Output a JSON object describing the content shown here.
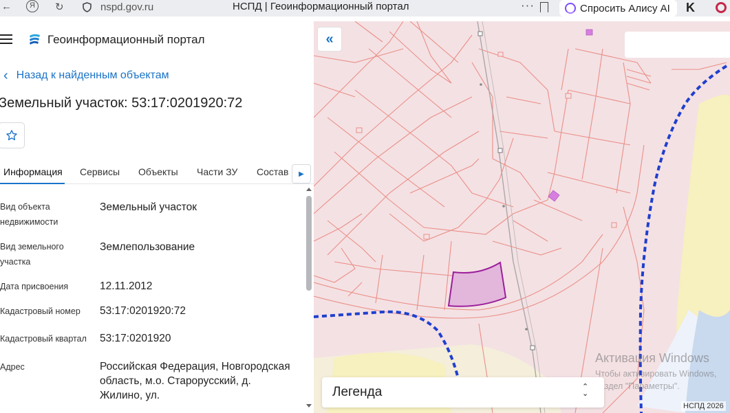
{
  "browser": {
    "url": "nspd.gov.ru",
    "tab_title": "НСПД | Геоинформационный портал",
    "alice_label": "Спросить Алису AI",
    "menu_dots": "···"
  },
  "header": {
    "portal_title": "Геоинформационный портал"
  },
  "navigation": {
    "back_label": "Назад к найденным объектам",
    "back_chevron": "‹"
  },
  "object": {
    "title": "Земельный участок: 53:17:0201920:72"
  },
  "tabs": [
    {
      "label": "Информация",
      "active": true
    },
    {
      "label": "Сервисы"
    },
    {
      "label": "Объекты"
    },
    {
      "label": "Части ЗУ"
    },
    {
      "label": "Состав"
    }
  ],
  "attributes": [
    {
      "label": "Вид объекта недвижимости",
      "value": "Земельный участок"
    },
    {
      "label": "Вид земельного участка",
      "value": "Землепользование"
    },
    {
      "label": "Дата присвоения",
      "value": "12.11.2012"
    },
    {
      "label": "Кадастровый номер",
      "value": "53:17:0201920:72"
    },
    {
      "label": "Кадастровый квартал",
      "value": "53:17:0201920"
    },
    {
      "label": "Адрес",
      "value": "Российская Федерация, Новгородская область, м.о. Старорусский, д. Жилино, ул."
    }
  ],
  "map": {
    "collapse_icon": "«",
    "legend_label": "Легенда",
    "copyright": "НСПД 2026",
    "colors": {
      "background": "#f4e1e4",
      "parcel_line": "#ea8f86",
      "selected_fill": "#e3b6dc",
      "selected_stroke": "#9b1d9b",
      "boundary": "#1f3fcf",
      "forest": "#f7f0bf",
      "water": "#c9d9ee"
    }
  },
  "watermark": {
    "title": "Активация Windows",
    "line1": "Чтобы активировать Windows,",
    "line2": "раздел \"Параметры\"."
  }
}
